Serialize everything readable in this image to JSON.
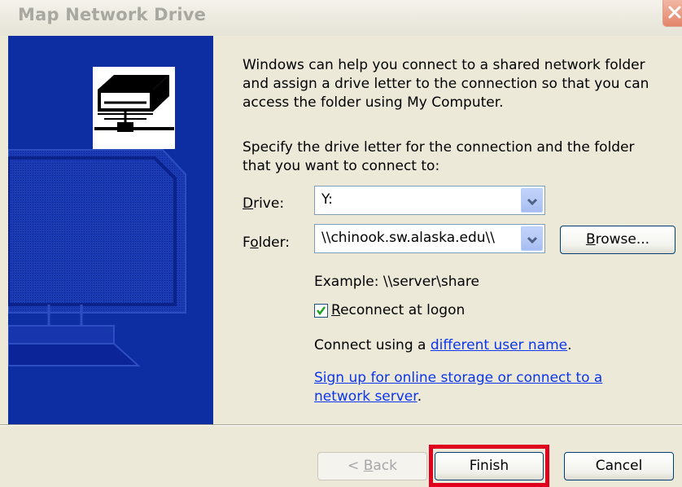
{
  "window": {
    "title": "Map Network Drive",
    "close_icon": "close-icon"
  },
  "intro": {
    "line1": "Windows can help you connect to a shared network folder",
    "line2": "and assign a drive letter to the connection so that you can",
    "line3": "access the folder using My Computer."
  },
  "specify": {
    "line1": "Specify the drive letter for the connection and the folder",
    "line2": "that you want to connect to:"
  },
  "drive": {
    "label_prefix": "",
    "label_mnemonic": "D",
    "label_rest": "rive:",
    "value": "Y:"
  },
  "folder": {
    "label_prefix": "F",
    "label_mnemonic": "o",
    "label_rest": "lder:",
    "value": "\\\\chinook.sw.alaska.edu\\\\",
    "browse_mnemonic": "B",
    "browse_rest": "rowse..."
  },
  "example": "Example: \\\\server\\share",
  "reconnect": {
    "mnemonic": "R",
    "rest": "econnect at logon",
    "checked": true
  },
  "connect_using": {
    "prefix": "Connect using a ",
    "link": "different user name",
    "suffix": "."
  },
  "signup": {
    "link_line1": "Sign up for online storage or connect to a",
    "link_line2": "network server",
    "suffix": "."
  },
  "buttons": {
    "back_prefix": "< ",
    "back_mnemonic": "B",
    "back_rest": "ack",
    "finish": "Finish",
    "cancel": "Cancel"
  },
  "colors": {
    "side_panel": "#0d2da3",
    "highlight": "#e0001e",
    "link": "#0b35ee"
  }
}
